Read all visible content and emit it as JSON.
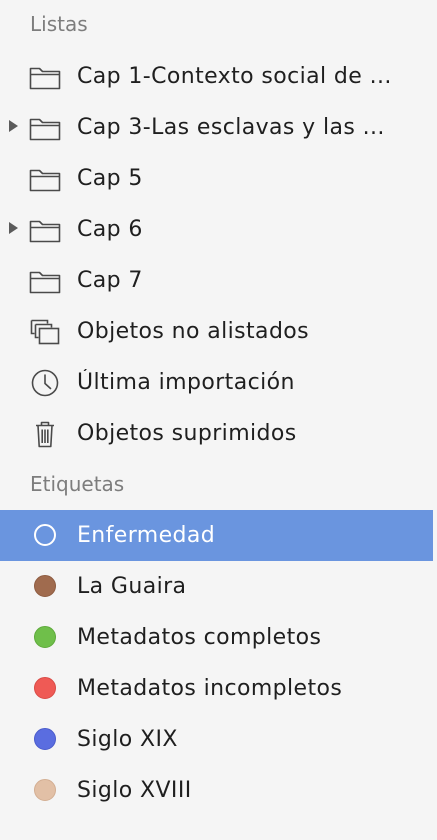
{
  "sidebar": {
    "lists_header": "Listas",
    "tags_header": "Etiquetas",
    "lists": [
      {
        "label": "Cap 1-Contexto social de ...",
        "icon": "folder-icon",
        "expandable": false
      },
      {
        "label": "Cap 3-Las esclavas y las ...",
        "icon": "folder-icon",
        "expandable": true
      },
      {
        "label": "Cap 5",
        "icon": "folder-icon",
        "expandable": false
      },
      {
        "label": "Cap 6",
        "icon": "folder-icon",
        "expandable": true
      },
      {
        "label": "Cap 7",
        "icon": "folder-icon",
        "expandable": false
      },
      {
        "label": "Objetos no alistados",
        "icon": "stacked-items-icon",
        "expandable": false
      },
      {
        "label": "Última importación",
        "icon": "clock-icon",
        "expandable": false
      },
      {
        "label": "Objetos suprimidos",
        "icon": "trash-icon",
        "expandable": false
      }
    ],
    "tags": [
      {
        "label": "Enfermedad",
        "color": "#6a95df",
        "selected": true
      },
      {
        "label": "La Guaira",
        "color": "#a06b4e",
        "selected": false
      },
      {
        "label": "Metadatos completos",
        "color": "#6fbf4a",
        "selected": false
      },
      {
        "label": "Metadatos incompletos",
        "color": "#ef5a55",
        "selected": false
      },
      {
        "label": "Siglo XIX",
        "color": "#5a6de0",
        "selected": false
      },
      {
        "label": "Siglo XVIII",
        "color": "#e2c0a6",
        "selected": false
      }
    ],
    "selection_color": "#6a95df"
  }
}
